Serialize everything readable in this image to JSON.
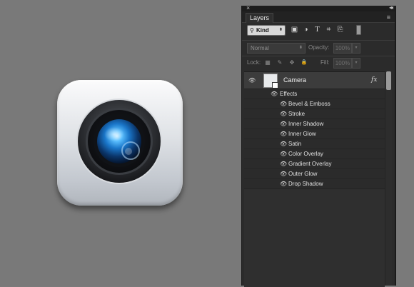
{
  "panel": {
    "close_glyph": "×",
    "collapse_glyph": "◂◂",
    "tab_label": "Layers",
    "menu_glyph": "≡"
  },
  "filter": {
    "search_glyph": "⚲",
    "kind_label": "Kind",
    "arrows": "⬍",
    "icons": [
      {
        "name": "pixel-layer-filter-icon",
        "glyph": "▣"
      },
      {
        "name": "adjustment-layer-filter-icon",
        "glyph": "◑"
      },
      {
        "name": "type-layer-filter-icon",
        "glyph": "T"
      },
      {
        "name": "shape-layer-filter-icon",
        "glyph": "⌗"
      },
      {
        "name": "smart-object-filter-icon",
        "glyph": "⎘"
      }
    ]
  },
  "blend": {
    "mode": "Normal",
    "arrows": "⬍",
    "opacity_label": "Opacity:",
    "opacity_value": "100%",
    "fill_label": "Fill:",
    "fill_value": "100%",
    "dropdown_glyph": "▾"
  },
  "lock": {
    "label": "Lock:",
    "icons": [
      {
        "name": "lock-transparent-pixels-icon",
        "glyph": "▦"
      },
      {
        "name": "lock-image-pixels-icon",
        "glyph": "✎"
      },
      {
        "name": "lock-position-icon",
        "glyph": "✥"
      },
      {
        "name": "lock-all-icon",
        "glyph": "🔒"
      }
    ]
  },
  "layer": {
    "eye_glyph": "👁",
    "name": "Camera",
    "fx_badge": "fx",
    "effects_label": "Effects",
    "effects": [
      "Bevel & Emboss",
      "Stroke",
      "Inner Shadow",
      "Inner Glow",
      "Satin",
      "Color Overlay",
      "Gradient Overlay",
      "Outer Glow",
      "Drop Shadow"
    ]
  },
  "colors": {
    "canvas": "#797979",
    "panel": "#2b2b2b",
    "lens_blue": "#2f8fe8"
  }
}
